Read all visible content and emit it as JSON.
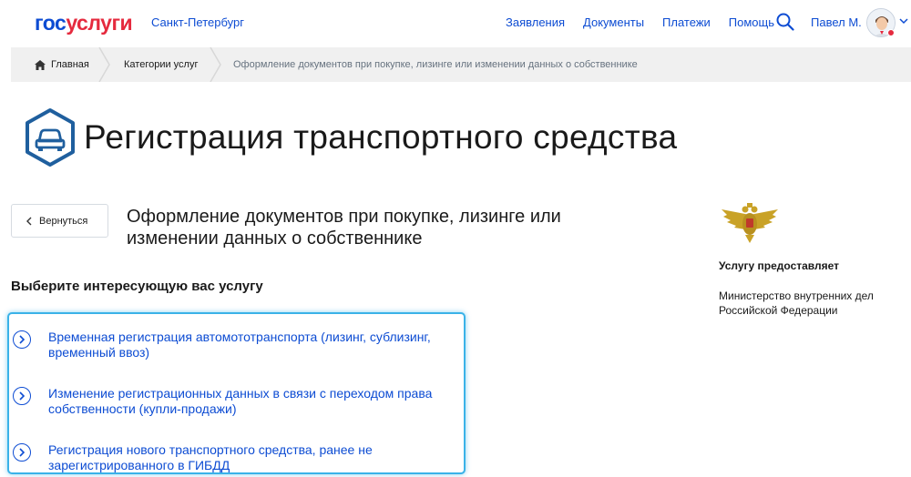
{
  "header": {
    "logo_gos": "гос",
    "logo_uslugi": "услуги",
    "region": "Санкт-Петербург",
    "nav": [
      "Заявления",
      "Документы",
      "Платежи",
      "Помощь"
    ],
    "user_name": "Павел М."
  },
  "breadcrumbs": {
    "home": "Главная",
    "category": "Категории услуг",
    "current": "Оформление документов при покупке, лизинге или изменении данных о собственнике"
  },
  "page": {
    "title": "Регистрация транспортного средства",
    "back_label": "Вернуться",
    "subtitle": "Оформление документов при покупке, лизинге или изменении данных о собственнике",
    "section_title": "Выберите интересующую вас услугу"
  },
  "services": [
    {
      "label": "Временная регистрация автомототранспорта (лизинг, сублизинг, временный ввоз)"
    },
    {
      "label": "Изменение регистрационных данных в связи с переходом права собственности (купли-продажи)"
    },
    {
      "label": "Регистрация нового транспортного средства, ранее не зарегистрированного в ГИБДД"
    }
  ],
  "provider": {
    "label": "Услугу предоставляет",
    "name": "Министерство внутренних дел Российской Федерации"
  },
  "colors": {
    "brand_blue": "#0d4cd3",
    "brand_red": "#e52a3e",
    "highlight": "#3ab2e8",
    "icon_blue": "#1f5f9e"
  }
}
